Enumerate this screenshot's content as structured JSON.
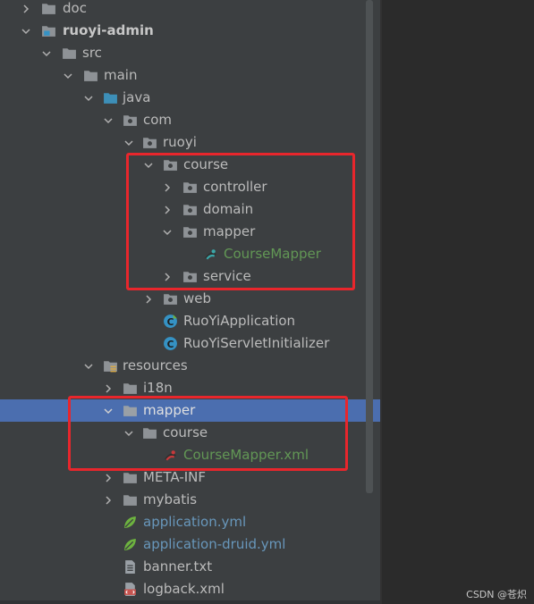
{
  "tree": {
    "rows": [
      {
        "label": "doc",
        "icon": "folder-icon",
        "expand": "chevron-right-icon"
      },
      {
        "label": "ruoyi-admin",
        "icon": "module-folder-icon",
        "expand": "chevron-down-icon"
      },
      {
        "label": "src",
        "icon": "folder-icon",
        "expand": "chevron-down-icon"
      },
      {
        "label": "main",
        "icon": "folder-icon",
        "expand": "chevron-down-icon"
      },
      {
        "label": "java",
        "icon": "source-root-icon",
        "expand": "chevron-down-icon"
      },
      {
        "label": "com",
        "icon": "package-icon",
        "expand": "chevron-down-icon"
      },
      {
        "label": "ruoyi",
        "icon": "package-icon",
        "expand": "chevron-down-icon"
      },
      {
        "label": "course",
        "icon": "package-icon",
        "expand": "chevron-down-icon"
      },
      {
        "label": "controller",
        "icon": "package-icon",
        "expand": "chevron-right-icon"
      },
      {
        "label": "domain",
        "icon": "package-icon",
        "expand": "chevron-right-icon"
      },
      {
        "label": "mapper",
        "icon": "package-icon",
        "expand": "chevron-down-icon"
      },
      {
        "label": "CourseMapper",
        "icon": "mybatis-interface-icon"
      },
      {
        "label": "service",
        "icon": "package-icon",
        "expand": "chevron-right-icon"
      },
      {
        "label": "web",
        "icon": "package-icon",
        "expand": "chevron-right-icon"
      },
      {
        "label": "RuoYiApplication",
        "icon": "spring-boot-class-icon"
      },
      {
        "label": "RuoYiServletInitializer",
        "icon": "class-icon"
      },
      {
        "label": "resources",
        "icon": "resources-root-icon",
        "expand": "chevron-down-icon"
      },
      {
        "label": "i18n",
        "icon": "folder-icon",
        "expand": "chevron-right-icon"
      },
      {
        "label": "mapper",
        "icon": "folder-icon",
        "expand": "chevron-down-icon"
      },
      {
        "label": "course",
        "icon": "folder-icon",
        "expand": "chevron-down-icon"
      },
      {
        "label": "CourseMapper.xml",
        "icon": "mybatis-xml-icon"
      },
      {
        "label": "META-INF",
        "icon": "folder-icon",
        "expand": "chevron-right-icon"
      },
      {
        "label": "mybatis",
        "icon": "folder-icon",
        "expand": "chevron-right-icon"
      },
      {
        "label": "application.yml",
        "icon": "spring-config-icon"
      },
      {
        "label": "application-druid.yml",
        "icon": "spring-config-icon"
      },
      {
        "label": "banner.txt",
        "icon": "text-file-icon"
      },
      {
        "label": "logback.xml",
        "icon": "xml-file-icon"
      }
    ]
  },
  "colors": {
    "tree_background": "#3c3f41",
    "selection": "#4b6eaf",
    "highlight_box": "#e8262c",
    "vcs_added_text": "#629755",
    "vcs_modified_text": "#6897bb"
  },
  "watermark": "CSDN @苍炽"
}
